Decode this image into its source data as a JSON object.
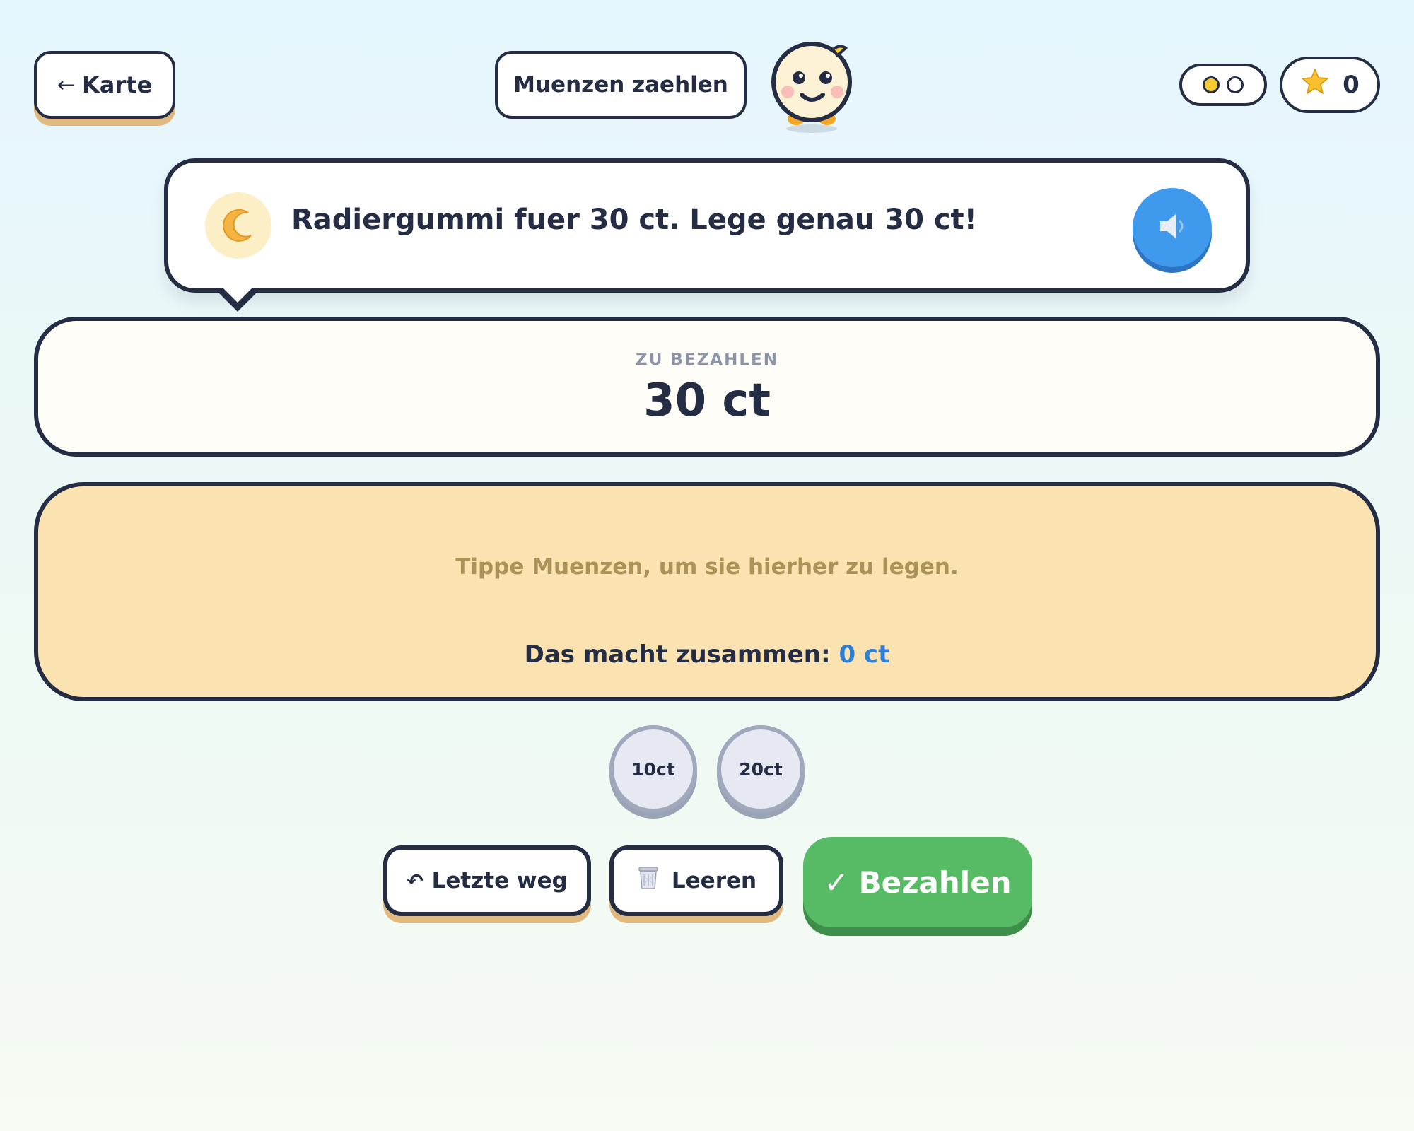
{
  "header": {
    "back_label": "Karte",
    "back_icon": "arrow-left-icon",
    "title": "Muenzen zaehlen",
    "progress": {
      "total": 2,
      "completed": 1
    },
    "stars": {
      "icon": "star-icon",
      "count": "0"
    }
  },
  "prompt": {
    "icon": "crescent-eraser-icon",
    "text": "Radiergummi fuer 30 ct. Lege genau 30 ct!",
    "speaker_icon": "speaker-icon"
  },
  "amount": {
    "label": "ZU BEZAHLEN",
    "value": "30 ct"
  },
  "tray": {
    "hint": "Tippe Muenzen, um sie hierher zu legen.",
    "total_label": "Das macht zusammen:",
    "total_value": "0 ct"
  },
  "coins": [
    {
      "label": "10ct"
    },
    {
      "label": "20ct"
    }
  ],
  "actions": {
    "undo_label": "Letzte weg",
    "undo_icon": "undo-icon",
    "clear_label": "Leeren",
    "clear_icon": "trash-icon",
    "pay_label": "Bezahlen",
    "pay_icon": "checkmark-icon"
  },
  "colors": {
    "ink": "#252d45",
    "tray": "#fae2b1",
    "pay": "#57ba64",
    "speaker": "#3f9aee",
    "total_value": "#2f7fd6"
  }
}
